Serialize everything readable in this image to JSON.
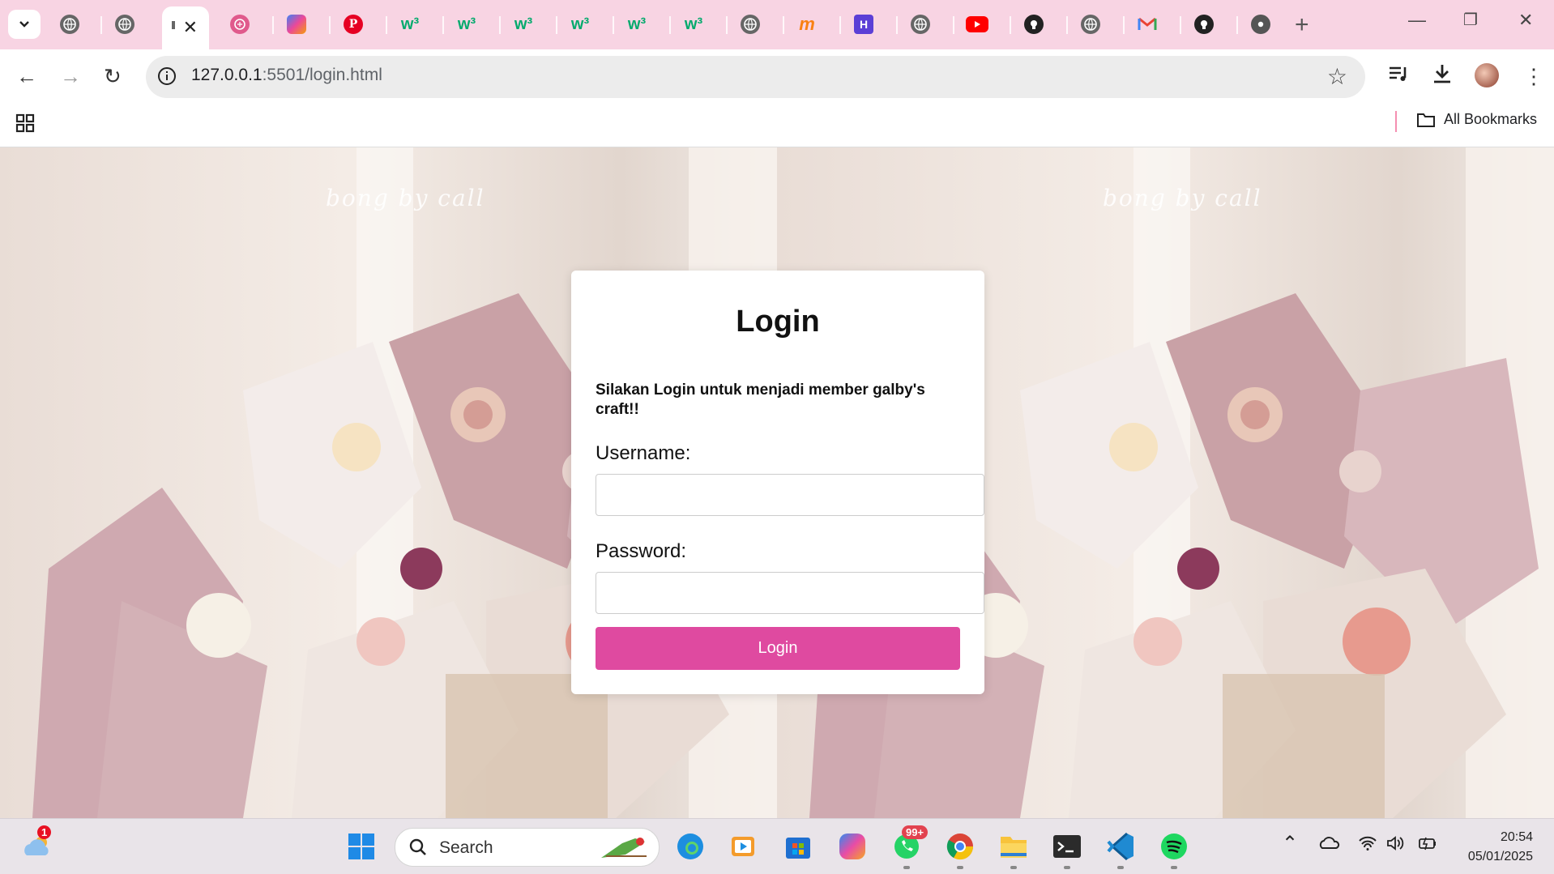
{
  "browser": {
    "tabs": [
      {
        "icon": "globe-icon"
      },
      {
        "icon": "globe-icon"
      },
      {
        "icon": "page-icon",
        "active": true
      },
      {
        "icon": "brain-icon"
      },
      {
        "icon": "copilot-icon"
      },
      {
        "icon": "pinterest-icon"
      },
      {
        "icon": "w3schools-icon"
      },
      {
        "icon": "w3schools-icon"
      },
      {
        "icon": "w3schools-icon"
      },
      {
        "icon": "w3schools-icon"
      },
      {
        "icon": "w3schools-icon"
      },
      {
        "icon": "w3schools-icon"
      },
      {
        "icon": "globe-icon"
      },
      {
        "icon": "moodle-icon"
      },
      {
        "icon": "h-icon"
      },
      {
        "icon": "globe-icon"
      },
      {
        "icon": "youtube-icon"
      },
      {
        "icon": "github-icon"
      },
      {
        "icon": "globe-icon"
      },
      {
        "icon": "gmail-icon"
      },
      {
        "icon": "github-icon"
      },
      {
        "icon": "chrome-icon"
      }
    ],
    "url_host": "127.0.0.1",
    "url_rest": ":5501/login.html",
    "bookmarks_label": "All Bookmarks"
  },
  "page": {
    "watermark": "bong by call",
    "login": {
      "title": "Login",
      "subtitle": "Silakan Login untuk menjadi member galby's craft!!",
      "username_label": "Username:",
      "password_label": "Password:",
      "button_label": "Login"
    }
  },
  "taskbar": {
    "weather_badge": "1",
    "search_label": "Search",
    "whatsapp_badge": "99+",
    "time": "20:54",
    "date": "05/01/2025"
  },
  "colors": {
    "tab_strip": "#f8d4e3",
    "login_button": "#df4aa0"
  }
}
